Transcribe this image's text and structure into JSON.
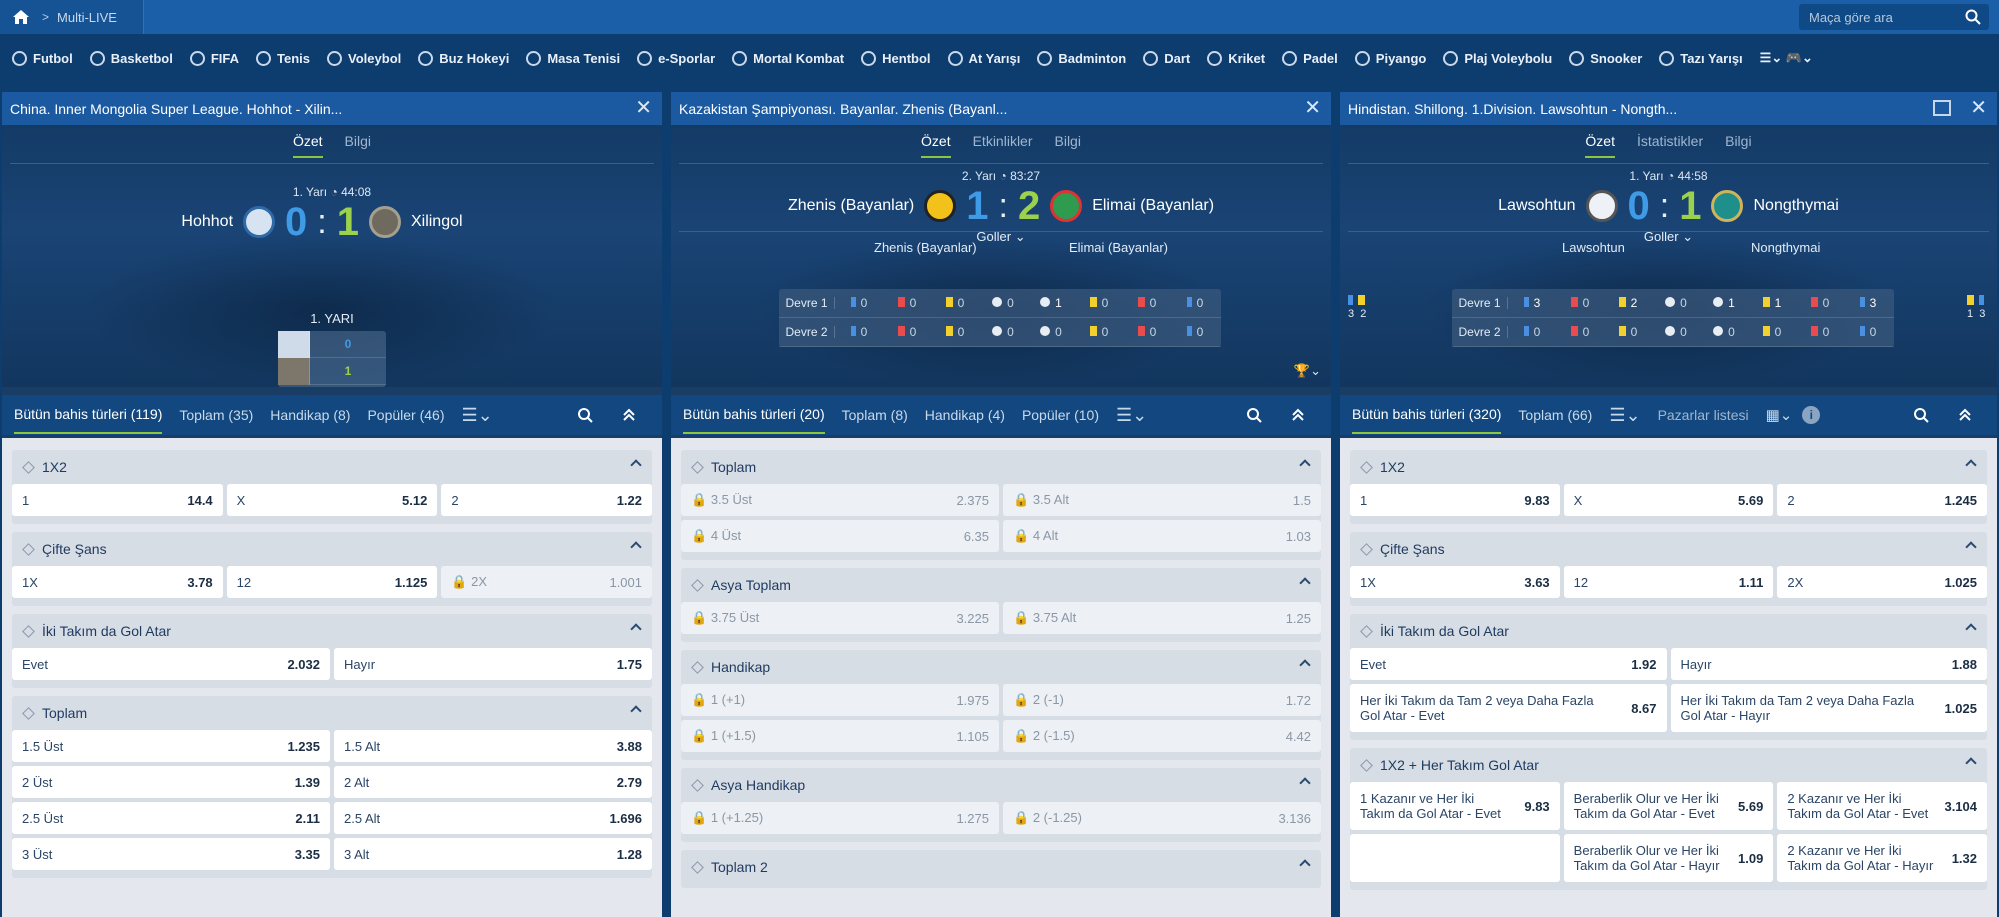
{
  "topbar": {
    "title": "Multi-LIVE",
    "search_placeholder": "Maça göre ara"
  },
  "sports": [
    "Futbol",
    "Basketbol",
    "FIFA",
    "Tenis",
    "Voleybol",
    "Buz Hokeyi",
    "Masa Tenisi",
    "e-Sporlar",
    "Mortal Kombat",
    "Hentbol",
    "At Yarışı",
    "Badminton",
    "Dart",
    "Kriket",
    "Padel",
    "Piyango",
    "Plaj Voleybolu",
    "Snooker",
    "Tazı Yarışı"
  ],
  "p1": {
    "title": "China. Inner Mongolia Super League. Hohhot - Xilin...",
    "tabs": [
      "Özet",
      "Bilgi"
    ],
    "half": "1. Yarı",
    "time": "44:08",
    "home": "Hohhot",
    "away": "Xilingol",
    "hs": "0",
    "as": "1",
    "mini_title": "1. YARI",
    "mini_home": "0",
    "mini_away": "1",
    "bets": [
      "Bütün bahis türleri (119)",
      "Toplam (35)",
      "Handikap (8)",
      "Popüler (46)"
    ],
    "g1": {
      "title": "1X2",
      "o": [
        [
          "1",
          "14.4"
        ],
        [
          "X",
          "5.12"
        ],
        [
          "2",
          "1.22"
        ]
      ]
    },
    "g2": {
      "title": "Çifte Şans",
      "o": [
        [
          "1X",
          "3.78"
        ],
        [
          "12",
          "1.125"
        ],
        [
          "2X",
          "1.001"
        ]
      ]
    },
    "g3": {
      "title": "İki Takım da Gol Atar",
      "o": [
        [
          "Evet",
          "2.032"
        ],
        [
          "Hayır",
          "1.75"
        ]
      ]
    },
    "g4": {
      "title": "Toplam",
      "o": [
        [
          "1.5 Üst",
          "1.235"
        ],
        [
          "1.5 Alt",
          "3.88"
        ],
        [
          "2 Üst",
          "1.39"
        ],
        [
          "2 Alt",
          "2.79"
        ],
        [
          "2.5 Üst",
          "2.11"
        ],
        [
          "2.5 Alt",
          "1.696"
        ],
        [
          "3 Üst",
          "3.35"
        ],
        [
          "3 Alt",
          "1.28"
        ]
      ]
    }
  },
  "p2": {
    "title": "Kazakistan Şampiyonası. Bayanlar. Zhenis (Bayanl...",
    "tabs": [
      "Özet",
      "Etkinlikler",
      "Bilgi"
    ],
    "half": "2. Yarı",
    "time": "83:27",
    "home": "Zhenis (Bayanlar)",
    "away": "Elimai (Bayanlar)",
    "hs": "1",
    "as": "2",
    "goals": "Goller",
    "d1": "Devre 1",
    "d2": "Devre 2",
    "r1": [
      "0",
      "0",
      "0",
      "0",
      "1",
      "0",
      "0",
      "0"
    ],
    "r2": [
      "0",
      "0",
      "0",
      "0",
      "0",
      "0",
      "0",
      "0"
    ],
    "bets": [
      "Bütün bahis türleri (20)",
      "Toplam (8)",
      "Handikap (4)",
      "Popüler (10)"
    ],
    "g1": {
      "title": "Toplam",
      "o": [
        [
          "3.5 Üst",
          "2.375"
        ],
        [
          "3.5 Alt",
          "1.5"
        ],
        [
          "4 Üst",
          "6.35"
        ],
        [
          "4 Alt",
          "1.03"
        ]
      ]
    },
    "g2": {
      "title": "Asya Toplam",
      "o": [
        [
          "3.75 Üst",
          "3.225"
        ],
        [
          "3.75 Alt",
          "1.25"
        ]
      ]
    },
    "g3": {
      "title": "Handikap",
      "o": [
        [
          "1 (+1)",
          "1.975"
        ],
        [
          "2 (-1)",
          "1.72"
        ],
        [
          "1 (+1.5)",
          "1.105"
        ],
        [
          "2 (-1.5)",
          "4.42"
        ]
      ]
    },
    "g4": {
      "title": "Asya Handikap",
      "o": [
        [
          "1 (+1.25)",
          "1.275"
        ],
        [
          "2 (-1.25)",
          "3.136"
        ]
      ]
    },
    "g5": {
      "title": "Toplam 2"
    }
  },
  "p3": {
    "title": "Hindistan. Shillong. 1.Division. Lawsohtun - Nongth...",
    "tabs": [
      "Özet",
      "İstatistikler",
      "Bilgi"
    ],
    "half": "1. Yarı",
    "time": "44:58",
    "home": "Lawsohtun",
    "away": "Nongthymai",
    "hs": "0",
    "as": "1",
    "goals": "Goller",
    "d1": "Devre 1",
    "d2": "Devre 2",
    "r1": [
      "3",
      "0",
      "2",
      "0",
      "1",
      "1",
      "0",
      "3"
    ],
    "r2": [
      "0",
      "0",
      "0",
      "0",
      "0",
      "0",
      "0",
      "0"
    ],
    "side_l": [
      "3",
      "2"
    ],
    "side_r": [
      "1",
      "3"
    ],
    "bets": [
      "Bütün bahis türleri (320)",
      "Toplam (66)"
    ],
    "market_list": "Pazarlar listesi",
    "g1": {
      "title": "1X2",
      "o": [
        [
          "1",
          "9.83"
        ],
        [
          "X",
          "5.69"
        ],
        [
          "2",
          "1.245"
        ]
      ]
    },
    "g2": {
      "title": "Çifte Şans",
      "o": [
        [
          "1X",
          "3.63"
        ],
        [
          "12",
          "1.11"
        ],
        [
          "2X",
          "1.025"
        ]
      ]
    },
    "g3": {
      "title": "İki Takım da Gol Atar",
      "o": [
        [
          "Evet",
          "1.92"
        ],
        [
          "Hayır",
          "1.88"
        ]
      ],
      "t": [
        [
          "Her İki Takım da Tam 2 veya Daha Fazla Gol Atar - Evet",
          "8.67"
        ],
        [
          "Her İki Takım da Tam 2 veya Daha Fazla Gol Atar - Hayır",
          "1.025"
        ]
      ]
    },
    "g4": {
      "title": "1X2 + Her Takım Gol Atar",
      "o": [
        [
          "1 Kazanır ve Her İki Takım da Gol Atar - Evet",
          "9.83"
        ],
        [
          "Beraberlik Olur ve Her İki Takım da Gol Atar - Evet",
          "5.69"
        ],
        [
          "2 Kazanır ve Her İki Takım da Gol Atar - Evet",
          "3.104"
        ],
        [
          "",
          ""
        ],
        [
          "Beraberlik Olur ve Her İki Takım da Gol Atar - Hayır",
          "1.09"
        ],
        [
          "2 Kazanır ve Her İki Takım da Gol Atar - Hayır",
          "1.32"
        ]
      ]
    }
  },
  "colors": {
    "accent": "#8cc63f",
    "home_score": "#3f9be6",
    "away_score": "#9bd14b"
  }
}
